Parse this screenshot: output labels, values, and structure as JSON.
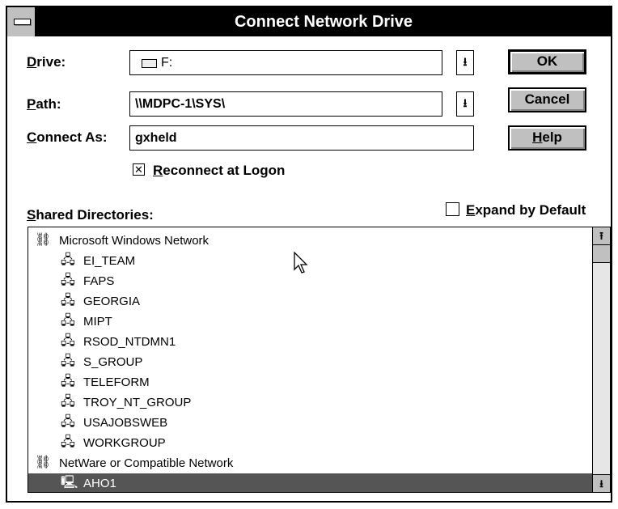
{
  "window": {
    "title": "Connect Network Drive"
  },
  "drive": {
    "label": "Drive:",
    "value": "F:"
  },
  "path": {
    "label": "Path:",
    "value": "\\\\MDPC-1\\SYS\\"
  },
  "connect_as": {
    "label": "Connect As:",
    "value": "gxheld"
  },
  "reconnect": {
    "label": "Reconnect at Logon",
    "checked": true
  },
  "buttons": {
    "ok": "OK",
    "cancel": "Cancel",
    "help": "Help"
  },
  "shared": {
    "label": "Shared Directories:"
  },
  "expand": {
    "label": "Expand by Default",
    "checked": false
  },
  "tree": [
    {
      "text": "Microsoft Windows Network",
      "type": "network",
      "level": 0
    },
    {
      "text": "EI_TEAM",
      "type": "workgroup",
      "level": 1
    },
    {
      "text": "FAPS",
      "type": "workgroup",
      "level": 1
    },
    {
      "text": "GEORGIA",
      "type": "workgroup",
      "level": 1
    },
    {
      "text": "MIPT",
      "type": "workgroup",
      "level": 1
    },
    {
      "text": "RSOD_NTDMN1",
      "type": "workgroup",
      "level": 1
    },
    {
      "text": "S_GROUP",
      "type": "workgroup",
      "level": 1
    },
    {
      "text": "TELEFORM",
      "type": "workgroup",
      "level": 1
    },
    {
      "text": "TROY_NT_GROUP",
      "type": "workgroup",
      "level": 1
    },
    {
      "text": "USAJOBSWEB",
      "type": "workgroup",
      "level": 1
    },
    {
      "text": "WORKGROUP",
      "type": "workgroup",
      "level": 1
    },
    {
      "text": "NetWare or Compatible Network",
      "type": "network",
      "level": 0
    },
    {
      "text": "AHO1",
      "type": "server",
      "level": 1,
      "selected": true
    }
  ]
}
